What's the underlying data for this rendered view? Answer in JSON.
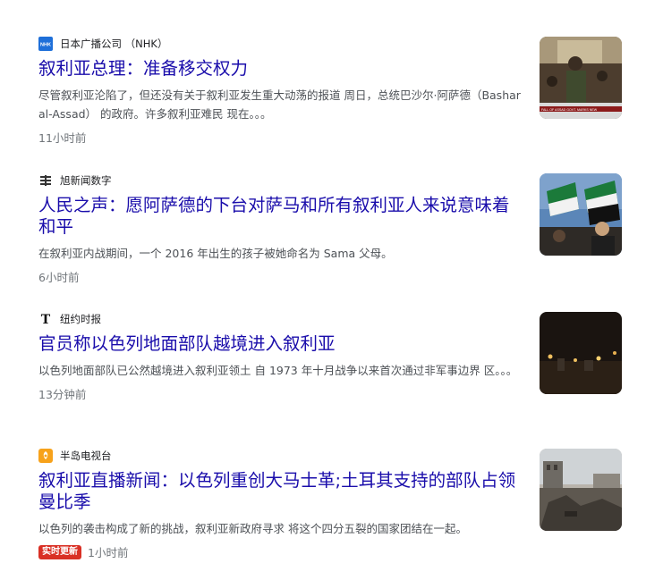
{
  "articles": [
    {
      "source": "日本广播公司 （NHK）",
      "source_icon": "nhk-logo-icon",
      "headline": "叙利亚总理：准备移交权力",
      "snippet": "尽管叙利亚沦陷了，但还没有关于叙利亚发生重大动荡的报道 周日，总统巴沙尔·阿萨德（Bashar al-Assad） 的政府。许多叙利亚难民 现在。。。",
      "time": "11小时前",
      "thumb_caption": "FALL OF ASSAD GOVT. MARKS NEW"
    },
    {
      "source": "旭新闻数字",
      "source_icon": "asahi-logo-icon",
      "headline": "人民之声：愿阿萨德的下台对萨马和所有叙利亚人来说意味着和平",
      "snippet": "在叙利亚内战期间，一个 2016 年出生的孩子被她命名为 Sama 父母。",
      "time": "6小时前"
    },
    {
      "source": "纽约时报",
      "source_icon": "nyt-logo-icon",
      "headline": "官员称以色列地面部队越境进入叙利亚",
      "snippet": "以色列地面部队已公然越境进入叙利亚领土 自 1973 年十月战争以来首次通过非军事边界 区。。。",
      "time": "13分钟前"
    },
    {
      "source": "半岛电视台",
      "source_icon": "aljazeera-logo-icon",
      "headline": "叙利亚直播新闻：以色列重创大马士革;土耳其支持的部队占领曼比季",
      "snippet": "以色列的袭击构成了新的挑战，叙利亚新政府寻求 将这个四分五裂的国家团结在一起。",
      "live_badge": "实时更新",
      "time": "1小时前"
    }
  ],
  "colors": {
    "headline": "#1a0dab",
    "snippet": "#4d5156",
    "time": "#70757a",
    "live_badge": "#d93025"
  }
}
